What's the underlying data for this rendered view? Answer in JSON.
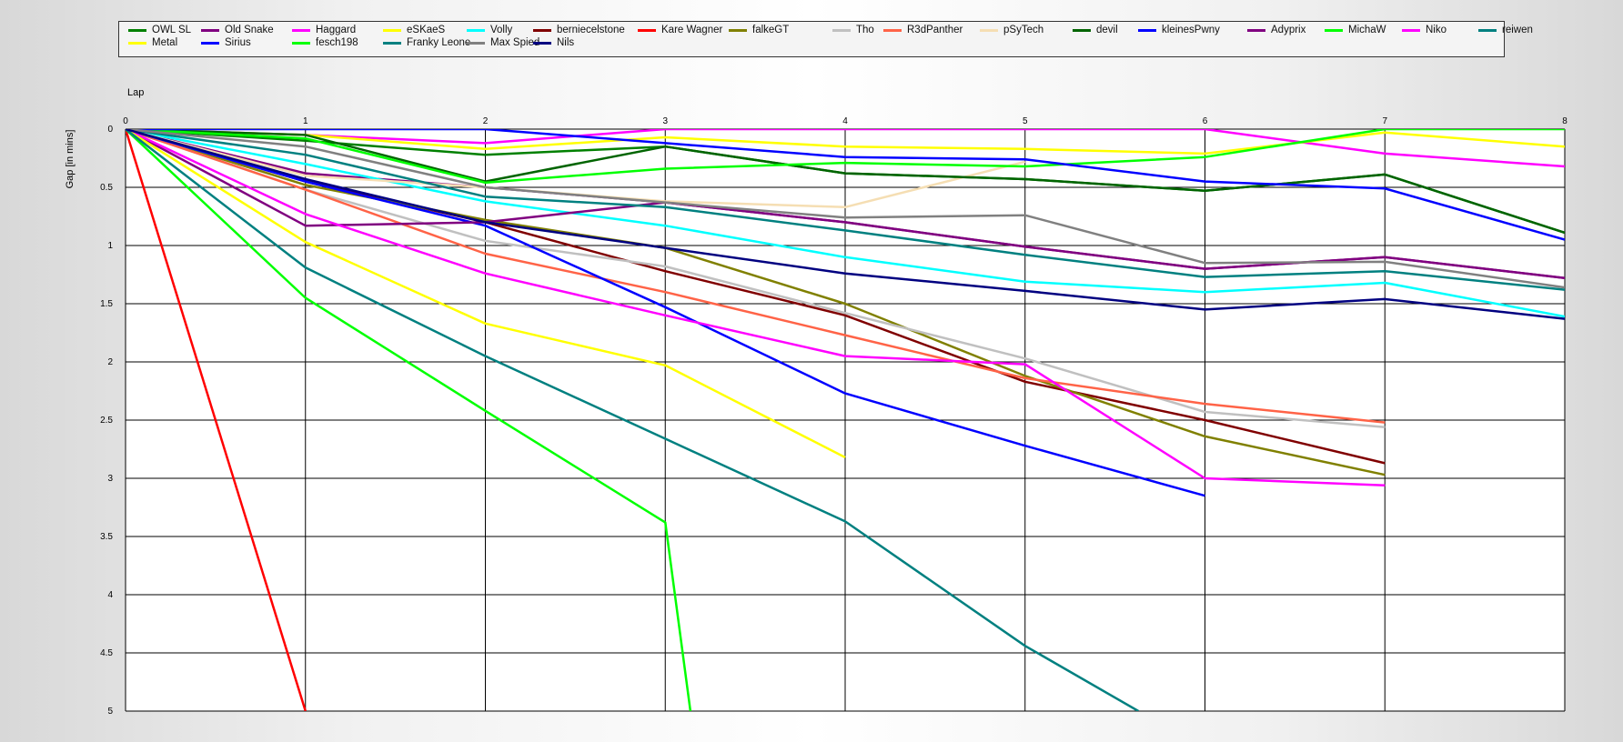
{
  "chart_data": {
    "type": "line",
    "xlabel": "Lap",
    "ylabel": "Gap [in mins]",
    "xlim": [
      0,
      8
    ],
    "ylim": [
      0,
      5
    ],
    "y_inverted": true,
    "x_ticks": [
      "0",
      "1",
      "2",
      "3",
      "4",
      "5",
      "6",
      "7",
      "8"
    ],
    "y_ticks": [
      "0",
      "0.5",
      "1",
      "1.5",
      "2",
      "2.5",
      "3",
      "3.5",
      "4",
      "4.5",
      "5"
    ],
    "grid": true,
    "legend_position": "top",
    "series": [
      {
        "name": "OWL SL",
        "color": "#008000",
        "x": [
          0,
          1,
          2,
          3,
          4,
          5,
          6,
          7,
          8
        ],
        "y": [
          0,
          0.1,
          0.22,
          0.15,
          0.38,
          0.43,
          0.53,
          0.39,
          0.89
        ]
      },
      {
        "name": "Old Snake",
        "color": "#800080",
        "x": [
          0,
          1,
          2,
          3,
          4,
          5,
          6,
          7,
          8
        ],
        "y": [
          0,
          0.38,
          0.5,
          0.63,
          0.8,
          1.01,
          1.2,
          1.1,
          1.28
        ]
      },
      {
        "name": "Haggard",
        "color": "#ff00ff",
        "x": [
          0,
          1,
          2,
          3,
          4,
          5,
          6,
          7,
          8
        ],
        "y": [
          0,
          0.05,
          0.12,
          0,
          0,
          0,
          0,
          0.21,
          0.32
        ]
      },
      {
        "name": "eSKaeS",
        "color": "#ffff00",
        "x": [
          0,
          1,
          2,
          3,
          4,
          5,
          6,
          7,
          8
        ],
        "y": [
          0,
          0.05,
          0.17,
          0.07,
          0.15,
          0.17,
          0.21,
          0.03,
          0.15
        ]
      },
      {
        "name": "Volly",
        "color": "#00ffff",
        "x": [
          0,
          1,
          2,
          3,
          4,
          5,
          6,
          7,
          8
        ],
        "y": [
          0,
          0.3,
          0.62,
          0.83,
          1.1,
          1.31,
          1.4,
          1.32,
          1.61
        ]
      },
      {
        "name": "berniecelstone",
        "color": "#800000",
        "x": [
          0,
          1,
          2,
          3,
          4,
          5,
          6,
          7
        ],
        "y": [
          0,
          0.45,
          0.8,
          1.22,
          1.6,
          2.17,
          2.5,
          2.87
        ]
      },
      {
        "name": "Kare Wagner",
        "color": "#ff0000",
        "x": [
          0,
          1
        ],
        "y": [
          0,
          5
        ]
      },
      {
        "name": "falkeGT",
        "color": "#808000",
        "x": [
          0,
          1,
          2,
          3,
          4,
          5,
          6,
          7
        ],
        "y": [
          0,
          0.48,
          0.78,
          1.02,
          1.5,
          2.12,
          2.64,
          2.97
        ]
      },
      {
        "name": "Tho",
        "color": "#c0c0c0",
        "x": [
          0,
          1,
          2,
          3,
          4,
          5,
          6,
          7
        ],
        "y": [
          0,
          0.52,
          0.96,
          1.18,
          1.58,
          1.97,
          2.43,
          2.56
        ]
      },
      {
        "name": "R3dPanther",
        "color": "#ff6347",
        "x": [
          0,
          1,
          2,
          3,
          4,
          5,
          6,
          7
        ],
        "y": [
          0,
          0.52,
          1.07,
          1.4,
          1.77,
          2.14,
          2.36,
          2.52
        ]
      },
      {
        "name": "pSyTech",
        "color": "#f5deb3",
        "x": [
          0,
          1,
          2,
          3,
          4,
          5
        ],
        "y": [
          0,
          0.4,
          0.5,
          0.62,
          0.67,
          0.28
        ]
      },
      {
        "name": "devil",
        "color": "#006400",
        "x": [
          0,
          1,
          2,
          3,
          4,
          5,
          6,
          7,
          8
        ],
        "y": [
          0,
          0.05,
          0.45,
          0.15,
          0.38,
          0.43,
          0.53,
          0.39,
          0.89
        ]
      },
      {
        "name": "kleinesPwny",
        "color": "#0000ff",
        "x": [
          0,
          1,
          2,
          3,
          4,
          5,
          6
        ],
        "y": [
          0,
          0.45,
          0.83,
          1.53,
          2.27,
          2.72,
          3.15
        ]
      },
      {
        "name": "Adyprix",
        "color": "#800080",
        "x": [
          0,
          1,
          2,
          3,
          4,
          5,
          6,
          7,
          8
        ],
        "y": [
          0,
          0.83,
          0.8,
          0.63,
          0.8,
          1.01,
          1.2,
          1.1,
          1.28
        ]
      },
      {
        "name": "MichaW",
        "color": "#00ff00",
        "x": [
          0,
          1,
          2,
          3,
          4,
          5,
          6,
          7,
          8
        ],
        "y": [
          0,
          0.08,
          0.46,
          0.34,
          0.29,
          0.32,
          0.24,
          0,
          0
        ]
      },
      {
        "name": "Niko",
        "color": "#ff00ff",
        "x": [
          0,
          1,
          2,
          3,
          4,
          5,
          6,
          7
        ],
        "y": [
          0,
          0.73,
          1.24,
          1.6,
          1.95,
          2.02,
          3.0,
          3.06
        ]
      },
      {
        "name": "reiwen",
        "color": "#008080",
        "x": [
          0,
          1,
          2,
          3,
          4,
          5,
          6,
          7,
          8
        ],
        "y": [
          0,
          0.22,
          0.58,
          0.67,
          0.87,
          1.08,
          1.27,
          1.22,
          1.38
        ]
      },
      {
        "name": "Metal",
        "color": "#ffff00",
        "x": [
          0,
          1,
          2,
          3,
          4
        ],
        "y": [
          0,
          0.97,
          1.67,
          2.03,
          2.82
        ]
      },
      {
        "name": "Sirius",
        "color": "#0000ff",
        "x": [
          0,
          1,
          2,
          3,
          4,
          5,
          6,
          7,
          8
        ],
        "y": [
          0,
          0,
          0,
          0.12,
          0.24,
          0.26,
          0.45,
          0.51,
          0.95
        ]
      },
      {
        "name": "fesch198",
        "color": "#00ff00",
        "x": [
          0,
          1,
          2,
          3,
          3.14
        ],
        "y": [
          0,
          1.45,
          2.42,
          3.38,
          5
        ]
      },
      {
        "name": "Franky Leone",
        "color": "#008080",
        "x": [
          0,
          1,
          2,
          3,
          4,
          5,
          5.63
        ],
        "y": [
          0,
          1.19,
          1.95,
          2.66,
          3.37,
          4.44,
          5
        ]
      },
      {
        "name": "Max Spied",
        "color": "#808080",
        "x": [
          0,
          1,
          2,
          3,
          4,
          5,
          6,
          7,
          8
        ],
        "y": [
          0,
          0.15,
          0.5,
          0.63,
          0.76,
          0.74,
          1.15,
          1.14,
          1.36
        ]
      },
      {
        "name": "Nils",
        "color": "#000080",
        "x": [
          0,
          1,
          2,
          3,
          4,
          5,
          6,
          7,
          8
        ],
        "y": [
          0,
          0.43,
          0.8,
          1.02,
          1.24,
          1.39,
          1.55,
          1.46,
          1.63
        ]
      }
    ]
  }
}
